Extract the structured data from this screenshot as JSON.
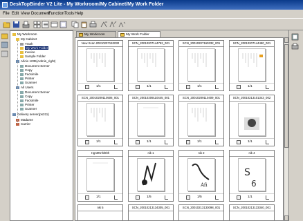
{
  "window": {
    "title": "DeskTopBinder V2 Lite - My Workroom/My Cabinet/My Work Folder"
  },
  "menu": {
    "items": [
      "File",
      "Edit",
      "View",
      "Document",
      "Function",
      "Tools",
      "Help"
    ]
  },
  "tree": {
    "items": [
      {
        "label": "My Workroom"
      },
      {
        "label": "My Cabinet"
      },
      {
        "label": "Trash"
      },
      {
        "label": "My Work Folder"
      },
      {
        "label": "Invoice"
      },
      {
        "label": "Sample Folder"
      },
      {
        "label": "Aficio 1035(Admin_right)"
      },
      {
        "label": "Document Server"
      },
      {
        "label": "Copy"
      },
      {
        "label": "Facsimile"
      },
      {
        "label": "Printer"
      },
      {
        "label": "Scanner"
      },
      {
        "label": "All Users"
      },
      {
        "label": "Document Server"
      },
      {
        "label": "Copy"
      },
      {
        "label": "Facsimile"
      },
      {
        "label": "Printer"
      },
      {
        "label": "Scanner"
      },
      {
        "label": "Delivery server(ps311)"
      },
      {
        "label": "Madame"
      },
      {
        "label": "Carrier"
      }
    ]
  },
  "tabs": [
    {
      "label": "My Workroom"
    },
    {
      "label": "My Work Folder"
    }
  ],
  "documents": [
    {
      "name": "New Scan 20010207153030",
      "pages": "1/1"
    },
    {
      "name": "SCN_20010207144752_001",
      "pages": "1/1"
    },
    {
      "name": "SCN_20010207160332_001",
      "pages": "1/1"
    },
    {
      "name": "SCN_20010207144450_001",
      "pages": "1/1"
    },
    {
      "name": "SCN_20010209110506_001",
      "pages": "1/1"
    },
    {
      "name": "SCN_20010209110445_001",
      "pages": "1/1"
    },
    {
      "name": "SCN_20010209110409_001",
      "pages": "1/1"
    },
    {
      "name": "SCN_20010213101343_002",
      "pages": "1/1"
    },
    {
      "name": "Hgn0Nnhl0/th",
      "pages": "1/1"
    },
    {
      "name": "nik 1",
      "pages": "1/5"
    },
    {
      "name": "nik 2",
      "pages": "1/5"
    },
    {
      "name": "nik 4",
      "pages": "1/1"
    },
    {
      "name": "nik 5",
      "pages": ""
    },
    {
      "name": "SCN_20010213134305_001",
      "pages": ""
    },
    {
      "name": "SCN_20010213133098_001",
      "pages": ""
    },
    {
      "name": "SCN_20010213133340_001",
      "pages": ""
    }
  ]
}
